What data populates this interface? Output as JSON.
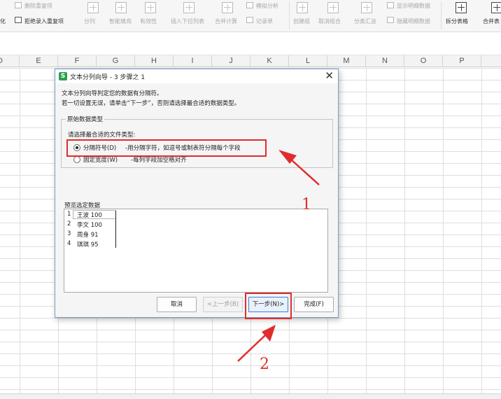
{
  "ribbon": {
    "row1": {
      "remove_dup": "删除重复项",
      "simulate": "模拟分析",
      "show_detail": "显示明细数据"
    },
    "row2": {
      "cut_label": "化",
      "reject_dup": "拒绝录入重复项",
      "split": "分列",
      "smart_fill": "智能填充",
      "validity": "有效性",
      "insert_dropdown": "插入下拉列表",
      "consolidate": "合并计算",
      "record": "记录单",
      "create_group": "创建组",
      "ungroup": "取消组合",
      "subtotal": "分类汇总",
      "hide_detail": "隐藏明细数据",
      "split_table": "拆分表格",
      "merge_table": "合并表"
    }
  },
  "columns": [
    "D",
    "E",
    "F",
    "G",
    "H",
    "I",
    "J",
    "K",
    "L",
    "M",
    "N",
    "O",
    "P"
  ],
  "dialog": {
    "title": "文本分列向导 - 3 步骤之 1",
    "close": "✕",
    "app_icon": "S",
    "desc_line1": "文本分列向导判定您的数据有分隔符。",
    "desc_line2": "若一切设置无误，请单击“下一步”，否则请选择最合适的数据类型。",
    "group_title": "原始数据类型",
    "choose_label": "请选择最合适的文件类型:",
    "option_delimited": "分隔符号(D)",
    "option_delimited_desc": "-用分隔字符，如逗号或制表符分隔每个字段",
    "option_fixed": "固定宽度(W)",
    "option_fixed_desc": "-每列字段加空格对齐",
    "preview_title": "预览选定数据",
    "preview_rows": [
      {
        "num": "1",
        "text": "王波 100"
      },
      {
        "num": "2",
        "text": "李文 100"
      },
      {
        "num": "3",
        "text": "周身 91"
      },
      {
        "num": "4",
        "text": "琪琪 95"
      }
    ],
    "buttons": {
      "cancel": "取消",
      "prev": "<上一步(B)",
      "next": "下一步(N)>",
      "finish": "完成(F)"
    }
  },
  "annotations": {
    "label1": "1",
    "label2": "2",
    "color": "#e02c2c"
  },
  "colors": {
    "dialog_border": "#7a9cc6",
    "app_icon": "#2e9f4e",
    "annotation": "#e02c2c"
  }
}
